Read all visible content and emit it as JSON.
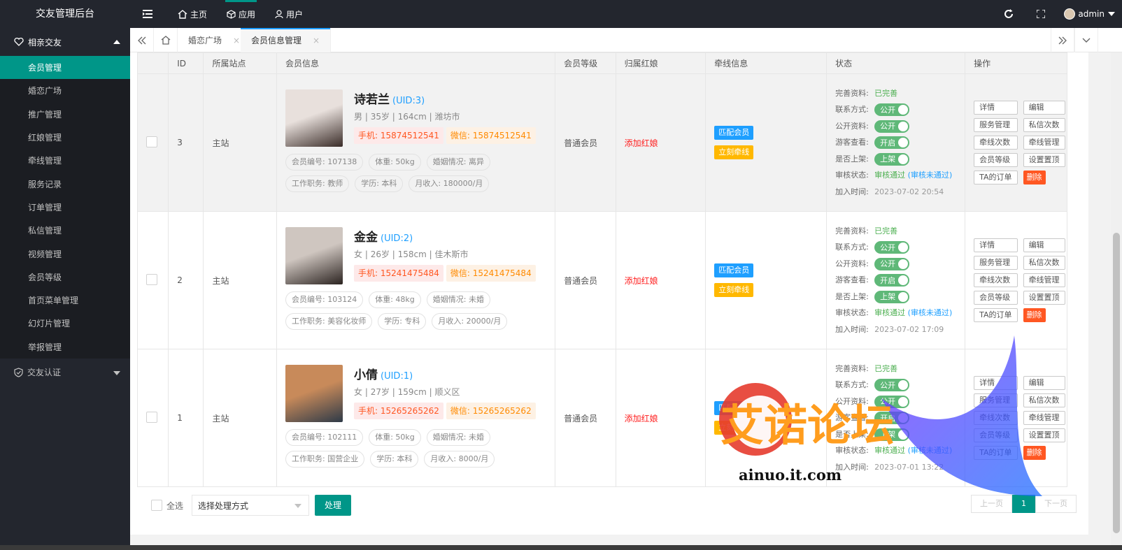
{
  "app": {
    "title": "交友管理后台"
  },
  "topnav": {
    "items": [
      {
        "label": "主页"
      },
      {
        "label": "应用"
      },
      {
        "label": "用户"
      }
    ],
    "user": "admin"
  },
  "sidebar": {
    "group1": "相亲交友",
    "items": [
      "会员管理",
      "婚恋广场",
      "推广管理",
      "红娘管理",
      "牵线管理",
      "服务记录",
      "订单管理",
      "私信管理",
      "视频管理",
      "会员等级",
      "首页菜单管理",
      "幻灯片管理",
      "举报管理"
    ],
    "group2": "交友认证"
  },
  "tabs": [
    {
      "label": "婚恋广场",
      "close": "×"
    },
    {
      "label": "会员信息管理",
      "close": "×"
    }
  ],
  "table": {
    "headers": [
      "ID",
      "所属站点",
      "会员信息",
      "会员等级",
      "归属红娘",
      "牵线信息",
      "状态",
      "操作"
    ],
    "rows": [
      {
        "id": "3",
        "site": "主站",
        "name": "诗若兰",
        "uid": "(UID:3)",
        "meta": "男 | 35岁 | 164cm | 潍坊市",
        "phone": "手机: 15874512541",
        "wechat": "微信: 15874512541",
        "no": "会员编号: 107138",
        "weight": "体重: 50kg",
        "marriage": "婚姻情况: 离异",
        "job": "工作职务: 教师",
        "edu": "学历: 本科",
        "income": "月收入: 180000/月",
        "level": "普通会员",
        "matchmaker": "添加红娘",
        "match_btn": "匹配会员",
        "link_btn": "立刻牵线",
        "time": "2023-07-02 20:54"
      },
      {
        "id": "2",
        "site": "主站",
        "name": "金金",
        "uid": "(UID:2)",
        "meta": "女 | 26岁 | 158cm | 佳木斯市",
        "phone": "手机: 15241475484",
        "wechat": "微信: 15241475484",
        "no": "会员编号: 103124",
        "weight": "体重: 48kg",
        "marriage": "婚姻情况: 未婚",
        "job": "工作职务: 美容化妆师",
        "edu": "学历: 专科",
        "income": "月收入: 20000/月",
        "level": "普通会员",
        "matchmaker": "添加红娘",
        "match_btn": "匹配会员",
        "link_btn": "立刻牵线",
        "time": "2023-07-02 17:09"
      },
      {
        "id": "1",
        "site": "主站",
        "name": "小倩",
        "uid": "(UID:1)",
        "meta": "女 | 27岁 | 159cm | 顺义区",
        "phone": "手机: 15265265262",
        "wechat": "微信: 15265265262",
        "no": "会员编号: 102111",
        "weight": "体重: 50kg",
        "marriage": "婚姻情况: 未婚",
        "job": "工作职务: 国营企业",
        "edu": "学历: 本科",
        "income": "月收入: 8000/月",
        "level": "普通会员",
        "matchmaker": "添加红娘",
        "match_btn": "匹配会员",
        "link_btn": "立刻牵线",
        "time": "2023-07-01 13:22"
      }
    ],
    "status_labels": {
      "profile": "完善资料:",
      "profile_val": "已完善",
      "contact": "联系方式:",
      "public": "公开资料:",
      "guest": "游客查看:",
      "shelf": "是否上架:",
      "audit": "审核状态:",
      "audit_ok": "审核通过",
      "audit_no": "审核未通过",
      "join": "加入时间:"
    },
    "switches": {
      "on": "公开",
      "open": "开启",
      "up": "上架"
    },
    "ops": [
      "详情",
      "编辑",
      "服务管理",
      "私信次数",
      "牵线次数",
      "牵线管理",
      "会员等级",
      "设置置顶",
      "TA的订单",
      "删除"
    ]
  },
  "footer": {
    "select_all": "全选",
    "select_placeholder": "选择处理方式",
    "process": "处理",
    "prev": "上一页",
    "page": "1",
    "next": "下一页"
  },
  "watermark": {
    "cn": "艾诺论坛",
    "en": "ainuo.it.com"
  },
  "colors": {
    "sidebar": "#23262e",
    "accent": "#009688",
    "blue": "#1e9fff",
    "danger": "#ff5722"
  }
}
